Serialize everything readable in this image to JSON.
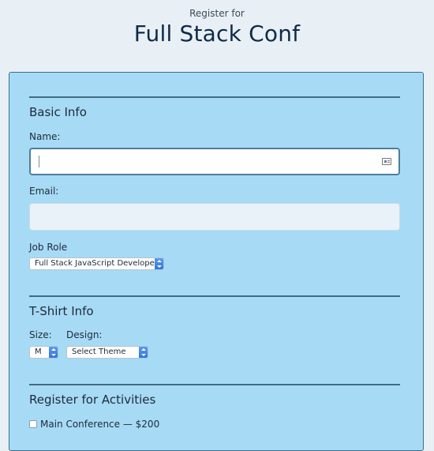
{
  "header": {
    "subtitle": "Register for",
    "title": "Full Stack Conf"
  },
  "basic_info": {
    "title": "Basic Info",
    "name_label": "Name:",
    "name_value": "",
    "email_label": "Email:",
    "email_value": "",
    "job_role_label": "Job Role",
    "job_role_selected": "Full Stack JavaScript Developer"
  },
  "tshirt_info": {
    "title": "T-Shirt Info",
    "size_label": "Size:",
    "size_selected": "M",
    "design_label": "Design:",
    "design_selected": "Select Theme"
  },
  "activities": {
    "title": "Register for Activities",
    "items": [
      {
        "label": "Main Conference — $200",
        "checked": false
      }
    ]
  },
  "colors": {
    "accent": "#a7daf5",
    "border": "#3f6d85",
    "select_arrow": "#2f74d6"
  }
}
